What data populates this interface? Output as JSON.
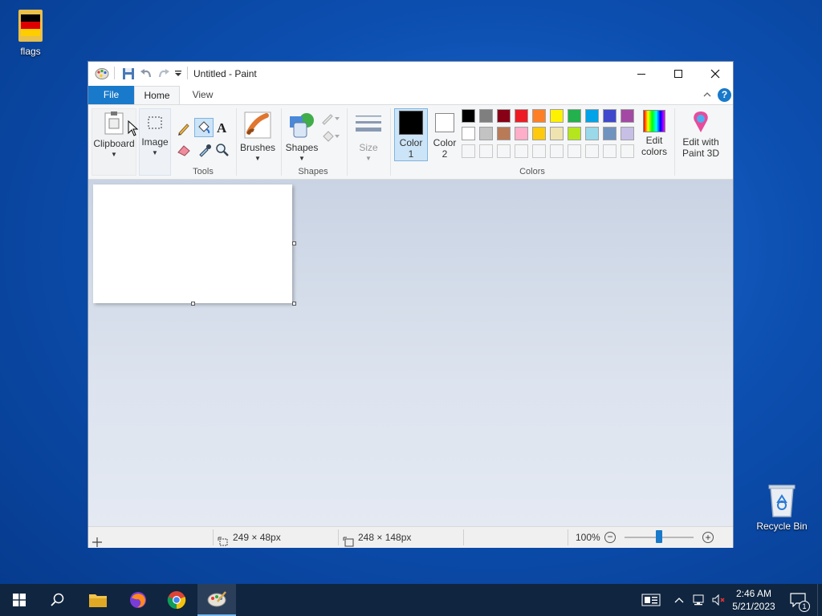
{
  "desktop": {
    "icons": [
      {
        "label": "flags"
      },
      {
        "label": "Recycle Bin"
      }
    ]
  },
  "window": {
    "title": "Untitled - Paint",
    "quick_access": [
      "save-icon",
      "undo-icon",
      "redo-icon",
      "customize-arrow-icon"
    ],
    "controls": [
      "minimize",
      "maximize",
      "close"
    ]
  },
  "ribbon": {
    "tabs": {
      "file": "File",
      "home": "Home",
      "view": "View"
    },
    "clipboard": {
      "label": "Clipboard"
    },
    "image": {
      "label": "Image"
    },
    "tools": {
      "label": "Tools"
    },
    "brushes": {
      "label": "Brushes"
    },
    "shapes": {
      "button_label": "Shapes",
      "group_label": "Shapes"
    },
    "size": {
      "label": "Size"
    },
    "color1": {
      "line1": "Color",
      "line2": "1",
      "value": "#000000"
    },
    "color2": {
      "line1": "Color",
      "line2": "2",
      "value": "#ffffff"
    },
    "colors_group_label": "Colors",
    "palette_row1": [
      "#000000",
      "#7f7f7f",
      "#880015",
      "#ed1c24",
      "#ff7f27",
      "#fff200",
      "#22b14c",
      "#00a2e8",
      "#3f48cc",
      "#a349a4"
    ],
    "palette_row2": [
      "#ffffff",
      "#c3c3c3",
      "#b97a57",
      "#ffaec9",
      "#ffc90e",
      "#efe4b0",
      "#b5e61d",
      "#99d9ea",
      "#7092be",
      "#c8bfe7"
    ],
    "edit_colors": {
      "line1": "Edit",
      "line2": "colors"
    },
    "paint3d": {
      "line1": "Edit with",
      "line2": "Paint 3D"
    }
  },
  "status": {
    "selection_size": "249 × 48px",
    "canvas_size": "248 × 148px",
    "zoom": "100%"
  },
  "taskbar": {
    "apps": [
      "start",
      "search",
      "file-explorer",
      "firefox",
      "chrome",
      "paint"
    ],
    "time": "2:46 AM",
    "date": "5/21/2023",
    "notification_count": "1"
  }
}
